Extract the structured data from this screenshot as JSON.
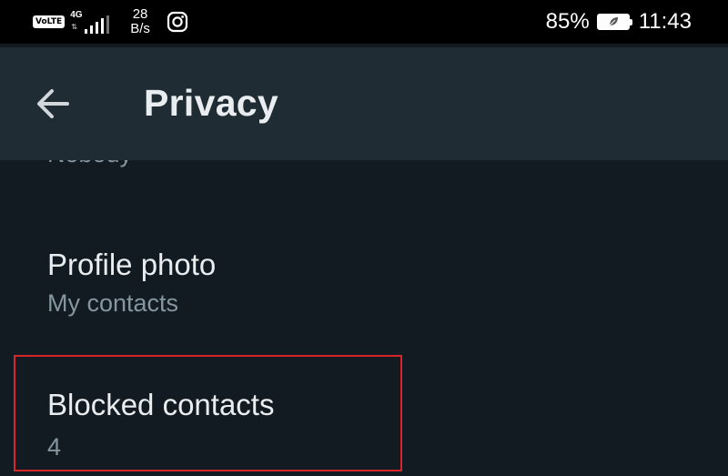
{
  "status_bar": {
    "volte": "VoLTE",
    "network": "4G",
    "signal_level": 4,
    "speed_value": "28",
    "speed_unit": "B/s",
    "apps": [
      "instagram-icon"
    ],
    "battery_percent": "85%",
    "battery_level": 0.85,
    "time": "11:43"
  },
  "app_bar": {
    "back_icon": "back-arrow-icon",
    "title": "Privacy"
  },
  "list": {
    "clipped_item_value": "Nobody",
    "items": [
      {
        "title": "Profile photo",
        "value": "My contacts"
      },
      {
        "title": "Blocked contacts",
        "value": "4"
      }
    ]
  },
  "colors": {
    "status_bar_bg": "#000000",
    "app_bar_bg": "#1f2c34",
    "page_bg": "#121b22",
    "primary_text": "#e9edef",
    "secondary_text": "#8696a0",
    "highlight_border": "#d6262b"
  }
}
